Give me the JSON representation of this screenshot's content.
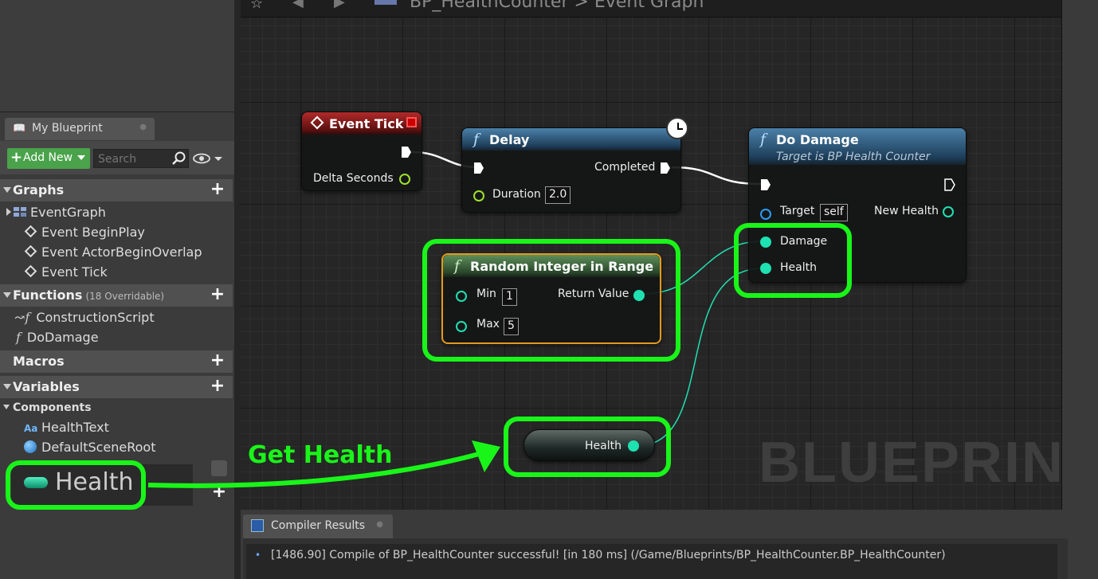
{
  "left_panel": {
    "tab_label": "My Blueprint",
    "add_new_label": "Add New",
    "search_placeholder": "Search",
    "graphs": {
      "title": "Graphs",
      "items": [
        "EventGraph",
        "Event BeginPlay",
        "Event ActorBeginOverlap",
        "Event Tick"
      ]
    },
    "functions": {
      "title": "Functions",
      "sub": "(18 Overridable)",
      "items": [
        "ConstructionScript",
        "DoDamage"
      ]
    },
    "macros_title": "Macros",
    "variables_title": "Variables",
    "components": {
      "title": "Components",
      "items": [
        "HealthText",
        "DefaultSceneRoot"
      ]
    },
    "health_variable": "Health"
  },
  "graph": {
    "breadcrumb": "BP_HealthCounter > Event Graph",
    "watermark": "BLUEPRINT",
    "nodes": {
      "event_tick": {
        "title": "Event Tick",
        "pin_delta": "Delta Seconds"
      },
      "delay": {
        "title": "Delay",
        "pin_completed": "Completed",
        "pin_duration": "Duration",
        "duration_value": "2.0"
      },
      "do_damage": {
        "title": "Do Damage",
        "subtitle": "Target is BP Health Counter",
        "pin_target": "Target",
        "target_value": "self",
        "pin_new_health": "New Health",
        "pin_damage": "Damage",
        "pin_health": "Health"
      },
      "random_int": {
        "title": "Random Integer in Range",
        "pin_min": "Min",
        "min_value": "1",
        "pin_max": "Max",
        "max_value": "5",
        "pin_return": "Return Value"
      },
      "get_health": {
        "label": "Health"
      }
    },
    "callout": "Get Health"
  },
  "compiler": {
    "tab_label": "Compiler Results",
    "message": "[1486.90] Compile of BP_HealthCounter successful! [in 180 ms] (/Game/Blueprints/BP_HealthCounter.BP_HealthCounter)"
  },
  "colors": {
    "highlight": "#19f519",
    "exec_wire": "#ffffff",
    "int_pin": "#1fe0b0",
    "object_pin": "#2a9df4",
    "float_pin": "#9fe02b"
  }
}
